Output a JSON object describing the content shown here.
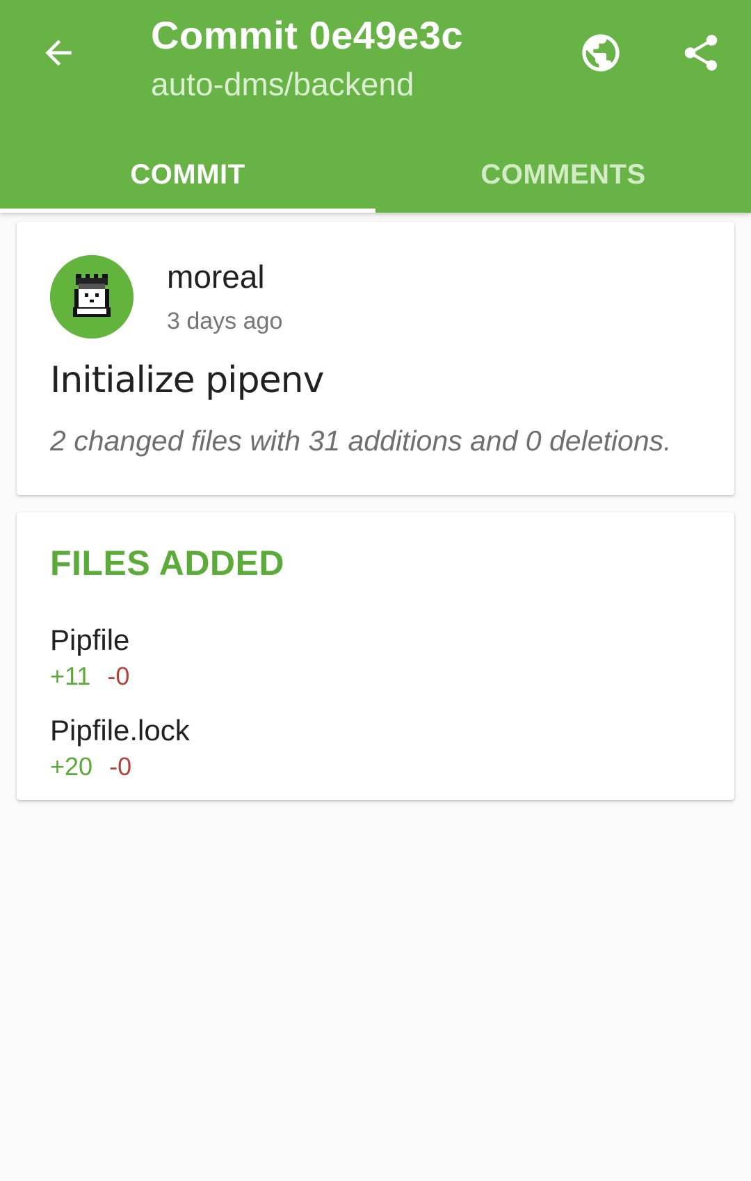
{
  "header": {
    "title": "Commit 0e49e3c",
    "subtitle": "auto-dms/backend",
    "back_icon": "arrow-back-icon",
    "browser_icon": "globe-icon",
    "share_icon": "share-icon",
    "background_color": "#67b346"
  },
  "tabs": [
    {
      "label": "COMMIT",
      "active": true
    },
    {
      "label": "COMMENTS",
      "active": false
    }
  ],
  "commit": {
    "author": "moreal",
    "time": "3 days ago",
    "message": "Initialize pipenv",
    "summary": "2 changed files with 31 additions and 0 deletions."
  },
  "files_added": {
    "header": "FILES ADDED",
    "files": [
      {
        "name": "Pipfile",
        "additions": "+11",
        "deletions": "-0"
      },
      {
        "name": "Pipfile.lock",
        "additions": "+20",
        "deletions": "-0"
      }
    ]
  },
  "colors": {
    "accent": "#5aab38",
    "addition": "#5aab38",
    "deletion": "#b2443c"
  }
}
